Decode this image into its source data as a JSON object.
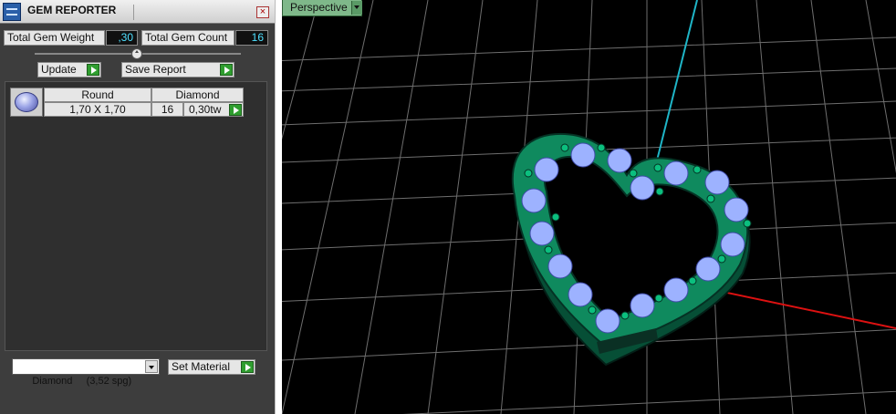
{
  "window": {
    "title": "GEM REPORTER"
  },
  "summary": {
    "total_weight_label": "Total Gem Weight",
    "total_weight_value": ",30",
    "total_count_label": "Total Gem Count",
    "total_count_value": "16"
  },
  "actions": {
    "update_label": "Update",
    "save_report_label": "Save Report"
  },
  "gem_list": {
    "items": [
      {
        "shape": "Round",
        "material": "Diamond",
        "size": "1,70 X 1,70",
        "count": "16",
        "weight": "0,30tw"
      }
    ]
  },
  "material": {
    "selected": "Diamond     (3,52 spg)",
    "set_material_label": "Set Material"
  },
  "viewport": {
    "view_label": "Perspective"
  },
  "colors": {
    "viewport_bg": "#000000",
    "accent": "#4ee0ff",
    "model": "#0f8a5e",
    "gem": "#9db2ff"
  },
  "icons": [
    "app-icon",
    "close-icon",
    "play-icon",
    "gem-icon",
    "chevron-down-icon"
  ]
}
